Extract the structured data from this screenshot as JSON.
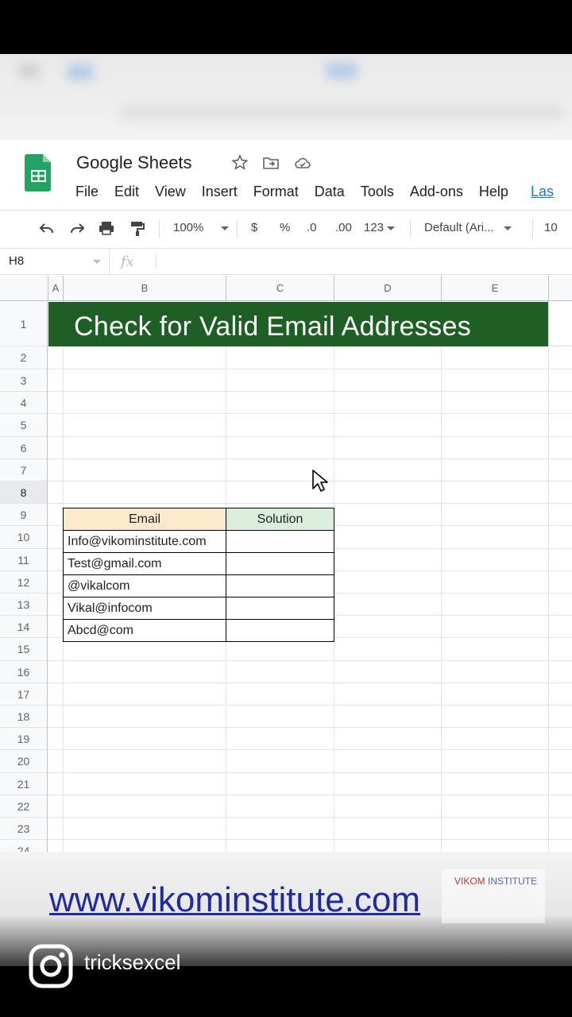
{
  "app": {
    "title": "Google Sheets",
    "menu": [
      "File",
      "Edit",
      "View",
      "Insert",
      "Format",
      "Data",
      "Tools",
      "Add-ons",
      "Help",
      "Las"
    ]
  },
  "toolbar": {
    "zoom": "100%",
    "currency": "$",
    "percent": "%",
    "decrease_decimal": ".0",
    "increase_decimal": ".00",
    "more_formats": "123",
    "font": "Default (Ari...",
    "font_size": "10"
  },
  "formula_bar": {
    "name_box": "H8",
    "fx": "fx"
  },
  "columns": [
    "A",
    "B",
    "C",
    "D",
    "E"
  ],
  "rows": [
    "1",
    "2",
    "3",
    "4",
    "5",
    "6",
    "7",
    "8",
    "9",
    "10",
    "11",
    "12",
    "13",
    "14",
    "15",
    "16",
    "17",
    "18",
    "19",
    "20",
    "21",
    "22",
    "23",
    "24"
  ],
  "sheet": {
    "title": "Check for Valid Email Addresses",
    "header_email": "Email",
    "header_solution": "Solution",
    "emails": [
      "Info@vikominstitute.com",
      "Test@gmail.com",
      "@vikalcom",
      "Vikal@infocom",
      "Abcd@com"
    ]
  },
  "overlay": {
    "website": "www.vikominstitute.com",
    "logo_part1": "VIKOM",
    "logo_part2": "INSTITUTE",
    "instagram_handle": "tricksexcel"
  },
  "colors": {
    "title_band": "#1e5f26",
    "email_header": "#fde9cb",
    "solution_header": "#dbeedb",
    "website": "#1f2a9c"
  }
}
